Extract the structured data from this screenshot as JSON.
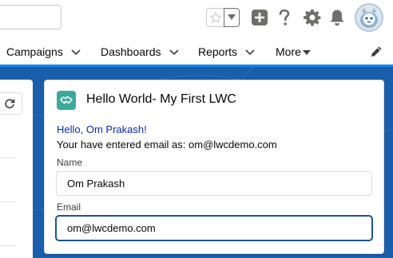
{
  "header": {
    "search": {
      "value": ""
    },
    "icons": [
      "favorite-star-icon",
      "chevron-down-icon",
      "add-icon",
      "help-icon",
      "setup-gear-icon",
      "notifications-bell-icon",
      "user-avatar"
    ]
  },
  "nav": {
    "items": [
      {
        "label": "Campaigns"
      },
      {
        "label": "Dashboards"
      },
      {
        "label": "Reports"
      },
      {
        "label": "More"
      }
    ]
  },
  "card": {
    "title": "Hello World- My First LWC",
    "greeting": "Hello, Om Prakash!",
    "email_message": "Your have entered email as: om@lwcdemo.com",
    "name_field": {
      "label": "Name",
      "value": "Om Prakash"
    },
    "email_field": {
      "label": "Email",
      "value": "om@lwcdemo.com"
    }
  },
  "colors": {
    "brand_blue": "#1589ee",
    "backdrop": "#1a5da8",
    "card_icon": "#3ba99c",
    "greeting_text": "#0b2bb5",
    "focus_border": "#1b5297"
  }
}
